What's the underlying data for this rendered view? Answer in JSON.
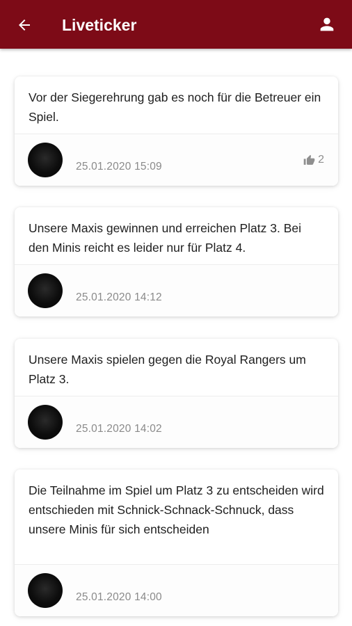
{
  "header": {
    "title": "Liveticker",
    "background_color": "#7d0b17",
    "back_icon": "arrow-left-icon",
    "profile_icon": "person-icon"
  },
  "posts": [
    {
      "text": "Vor der Siegerehrung gab es noch für die Betreuer ein Spiel.",
      "timestamp": "25.01.2020 15:09",
      "likes": "2"
    },
    {
      "text": "Unsere Maxis gewinnen und erreichen Platz 3. Bei den Minis reicht es leider nur für Platz 4.",
      "timestamp": "25.01.2020 14:12"
    },
    {
      "text": "Unsere Maxis spielen gegen die Royal Rangers um Platz 3.",
      "timestamp": "25.01.2020 14:02"
    },
    {
      "text": "Die Teilnahme im Spiel um Platz 3 zu entscheiden wird entschieden mit Schnick-Schnack-Schnuck, dass unsere Minis für sich entscheiden",
      "timestamp": "25.01.2020 14:00"
    }
  ]
}
